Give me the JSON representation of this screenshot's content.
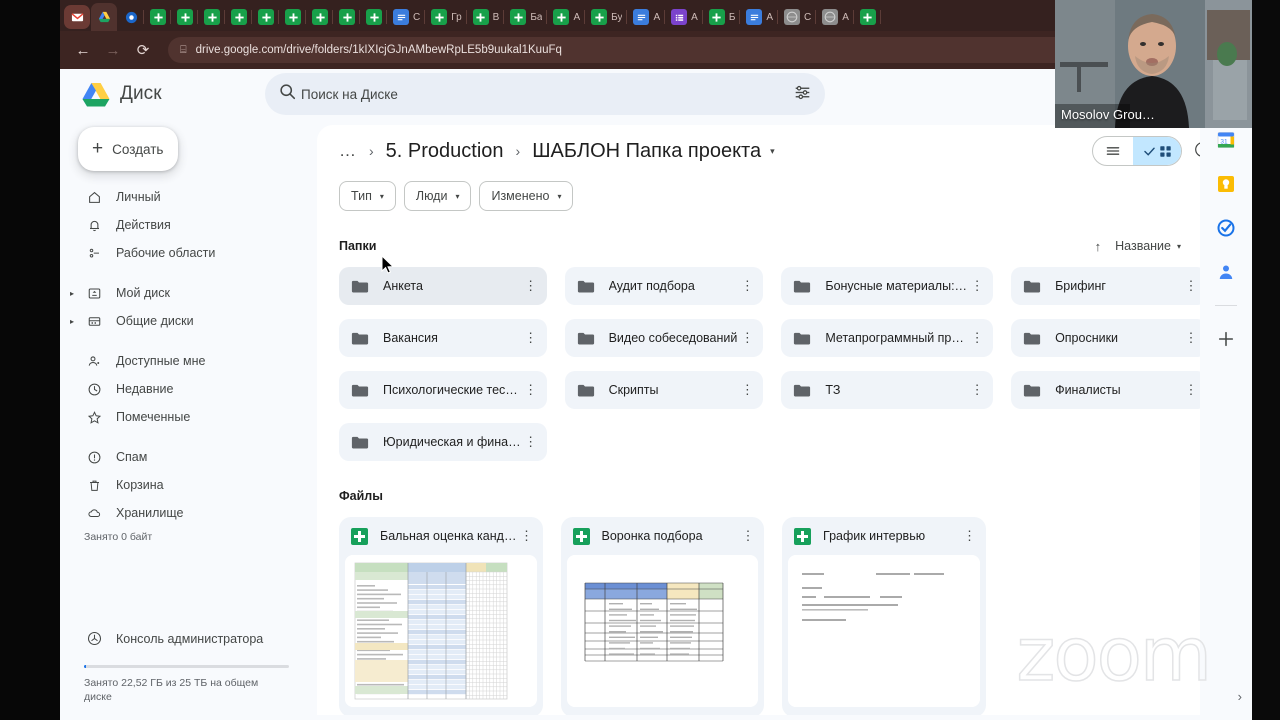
{
  "browser": {
    "url": "drive.google.com/drive/folders/1kIXIcjGJnAMbewRpLE5b9uukal1KuuFq",
    "back_icon": "←",
    "forward_icon": "→",
    "reload_icon": "⟳",
    "site_info_icon": "⌸",
    "cast_icon": "⬚",
    "bookmark_icon": "☆",
    "tabs": [
      {
        "title": "",
        "favicon": "M",
        "type": "gmail"
      },
      {
        "title": "",
        "favicon": "△",
        "type": "drive"
      },
      {
        "title": "",
        "favicon": "◉",
        "type": "blue"
      },
      {
        "title": "",
        "favicon": "",
        "type": "sheets"
      },
      {
        "title": "",
        "favicon": "",
        "type": "sheets"
      },
      {
        "title": "",
        "favicon": "",
        "type": "sheets"
      },
      {
        "title": "",
        "favicon": "",
        "type": "sheets"
      },
      {
        "title": "",
        "favicon": "",
        "type": "sheets"
      },
      {
        "title": "",
        "favicon": "",
        "type": "sheets"
      },
      {
        "title": "",
        "favicon": "",
        "type": "sheets"
      },
      {
        "title": "",
        "favicon": "",
        "type": "sheets"
      },
      {
        "title": "",
        "favicon": "",
        "type": "sheets"
      },
      {
        "title": "C",
        "favicon": "",
        "type": "docs"
      },
      {
        "title": "Гр",
        "favicon": "",
        "type": "sheets"
      },
      {
        "title": "В",
        "favicon": "",
        "type": "sheets"
      },
      {
        "title": "Ба",
        "favicon": "",
        "type": "sheets"
      },
      {
        "title": "А",
        "favicon": "",
        "type": "sheets"
      },
      {
        "title": "Бу",
        "favicon": "",
        "type": "sheets"
      },
      {
        "title": "А",
        "favicon": "",
        "type": "docs"
      },
      {
        "title": "А",
        "favicon": "",
        "type": "forms"
      },
      {
        "title": "Б",
        "favicon": "",
        "type": "sheets"
      },
      {
        "title": "А",
        "favicon": "",
        "type": "docs"
      },
      {
        "title": "C",
        "favicon": "",
        "type": "gray"
      },
      {
        "title": "A",
        "favicon": "",
        "type": "gray"
      },
      {
        "title": "",
        "favicon": "",
        "type": "sheets"
      }
    ]
  },
  "app": {
    "brand": "Диск",
    "search": {
      "placeholder": "Поиск на Диске",
      "search_icon": "search-icon",
      "tune_icon": "tune-icon"
    },
    "header_icons": [
      {
        "name": "activity-icon",
        "glyph": "✔"
      },
      {
        "name": "help-icon",
        "glyph": "?"
      },
      {
        "name": "settings-icon",
        "glyph": "⚙"
      }
    ]
  },
  "sidebar": {
    "new_button": "Создать",
    "new_plus": "+",
    "groups": [
      [
        {
          "label": "Личный",
          "icon": "home-icon",
          "glyph": "⌂",
          "caret": false
        },
        {
          "label": "Действия",
          "icon": "bell-icon",
          "glyph": "△",
          "caret": false
        },
        {
          "label": "Рабочие области",
          "icon": "workspaces-icon",
          "glyph": "∴",
          "caret": false
        }
      ],
      [
        {
          "label": "Мой диск",
          "icon": "my-drive-icon",
          "glyph": "▣",
          "caret": true
        },
        {
          "label": "Общие диски",
          "icon": "shared-drives-icon",
          "glyph": "▤",
          "caret": true
        }
      ],
      [
        {
          "label": "Доступные мне",
          "icon": "shared-with-me-icon",
          "glyph": "☺",
          "caret": false
        },
        {
          "label": "Недавние",
          "icon": "recent-icon",
          "glyph": "◴",
          "caret": false
        },
        {
          "label": "Помеченные",
          "icon": "star-icon",
          "glyph": "☆",
          "caret": false
        }
      ],
      [
        {
          "label": "Спам",
          "icon": "spam-icon",
          "glyph": "ⓘ",
          "caret": false
        },
        {
          "label": "Корзина",
          "icon": "trash-icon",
          "glyph": "⌧",
          "caret": false
        },
        {
          "label": "Хранилище",
          "icon": "cloud-icon",
          "glyph": "☁",
          "caret": false
        }
      ]
    ],
    "storage_note": "Занято 0 байт",
    "admin_console": "Консоль администратора",
    "storage_text": "Занято 22,52 ГБ из 25 ТБ на общем диске"
  },
  "breadcrumb": {
    "overflow": "…",
    "separator": "›",
    "parent": "5. Production",
    "current": "ШАБЛОН Папка проекта",
    "caret": "▾"
  },
  "toolbar": {
    "list_view_icon": "list-view-icon",
    "grid_view_icon": "grid-view-icon",
    "grid_selected_check": "✓",
    "info_icon": "ⓘ"
  },
  "filters": [
    {
      "label": "Тип",
      "caret": "▾"
    },
    {
      "label": "Люди",
      "caret": "▾"
    },
    {
      "label": "Изменено",
      "caret": "▾"
    }
  ],
  "folders_section": {
    "title": "Папки",
    "sort_arrow": "↑",
    "sort_label": "Название",
    "sort_caret": "▾",
    "kebab": "⋮",
    "items": [
      {
        "name": "Анкета",
        "hovered": true
      },
      {
        "name": "Аудит подбора",
        "hovered": false
      },
      {
        "name": "Бонусные материалы:…",
        "hovered": false
      },
      {
        "name": "Брифинг",
        "hovered": false
      },
      {
        "name": "Вакансия",
        "hovered": false
      },
      {
        "name": "Видео собеседований",
        "hovered": false
      },
      {
        "name": "Метапрограммный пр…",
        "hovered": false
      },
      {
        "name": "Опросники",
        "hovered": false
      },
      {
        "name": "Психологические тес…",
        "hovered": false
      },
      {
        "name": "Скрипты",
        "hovered": false
      },
      {
        "name": "ТЗ",
        "hovered": false
      },
      {
        "name": "Финалисты",
        "hovered": false
      },
      {
        "name": "Юридическая и фина…",
        "hovered": false
      }
    ]
  },
  "files_section": {
    "title": "Файлы",
    "items": [
      {
        "name": "Бальная оценка канд…",
        "type": "sheets",
        "thumb": "dense-spreadsheet"
      },
      {
        "name": "Воронка подбора",
        "type": "sheets",
        "thumb": "table-spreadsheet"
      },
      {
        "name": "График интервью",
        "type": "sheets",
        "thumb": "text-doc"
      }
    ]
  },
  "right_rail": {
    "items": [
      {
        "name": "calendar-icon",
        "label": "31"
      },
      {
        "name": "keep-icon",
        "label": ""
      },
      {
        "name": "tasks-icon",
        "label": ""
      },
      {
        "name": "contacts-icon",
        "label": ""
      }
    ],
    "add_icon": "+",
    "expand_chevron": "›"
  },
  "overlay": {
    "participant_name": "Mosolov Grou…",
    "watermark": "zoom"
  }
}
